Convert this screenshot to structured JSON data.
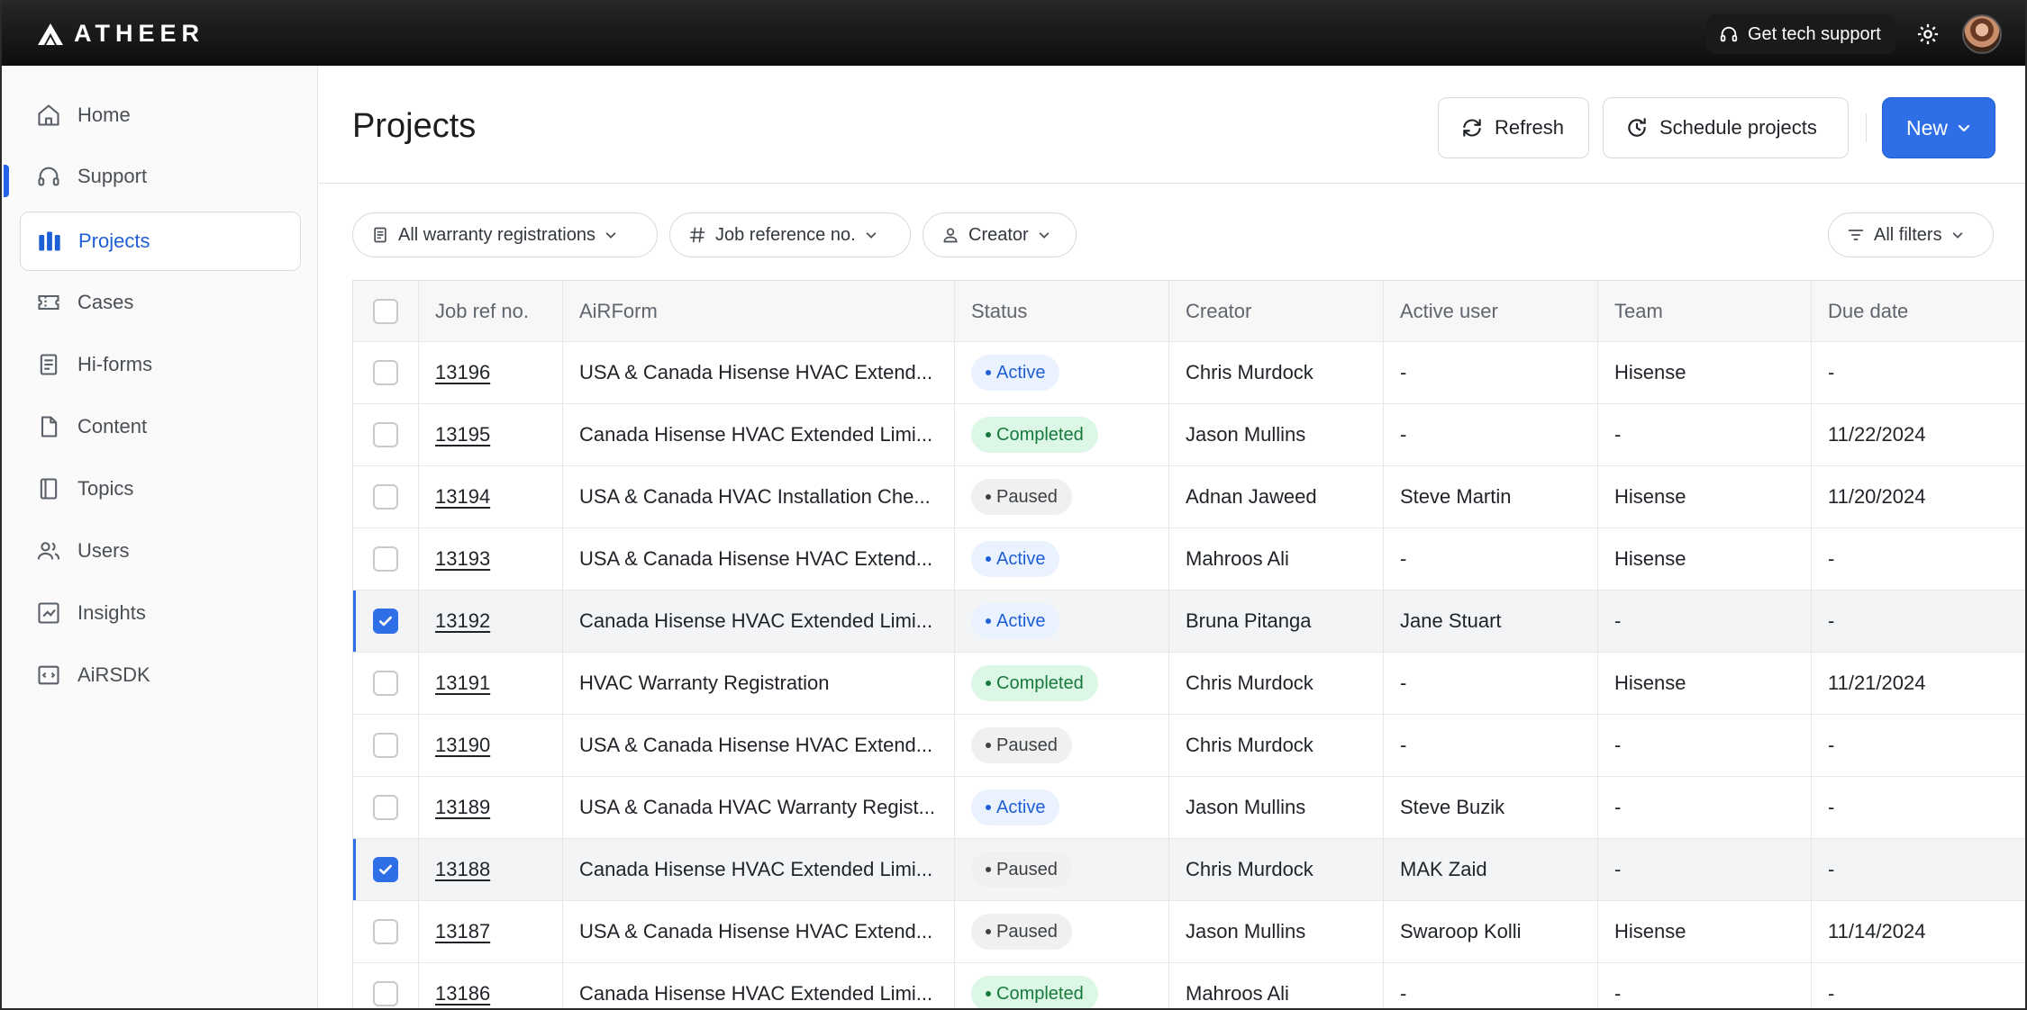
{
  "app": {
    "brand": "ATHEER",
    "support_label": "Get tech support"
  },
  "sidebar": {
    "items": [
      {
        "label": "Home",
        "icon": "home-icon"
      },
      {
        "label": "Support",
        "icon": "headset-icon"
      },
      {
        "label": "Projects",
        "icon": "projects-icon",
        "active": true
      },
      {
        "label": "Cases",
        "icon": "ticket-icon"
      },
      {
        "label": "Hi-forms",
        "icon": "form-icon"
      },
      {
        "label": "Content",
        "icon": "document-icon"
      },
      {
        "label": "Topics",
        "icon": "book-icon"
      },
      {
        "label": "Users",
        "icon": "users-icon"
      },
      {
        "label": "Insights",
        "icon": "chart-icon"
      },
      {
        "label": "AiRSDK",
        "icon": "code-icon"
      }
    ]
  },
  "header": {
    "title": "Projects",
    "refresh_label": "Refresh",
    "schedule_label": "Schedule projects",
    "new_label": "New"
  },
  "filters": {
    "warranty": "All warranty registrations",
    "jobref": "Job reference no.",
    "creator": "Creator",
    "all": "All filters"
  },
  "table": {
    "columns": [
      "Job ref no.",
      "AiRForm",
      "Status",
      "Creator",
      "Active user",
      "Team",
      "Due date"
    ],
    "rows": [
      {
        "checked": false,
        "job": "13196",
        "form": "USA & Canada Hisense HVAC Extend...",
        "status": "Active",
        "status_kind": "active",
        "creator": "Chris Murdock",
        "active_user": "-",
        "team": "Hisense",
        "due": "-"
      },
      {
        "checked": false,
        "job": "13195",
        "form": "Canada Hisense HVAC Extended Limi...",
        "status": "Completed",
        "status_kind": "completed",
        "creator": "Jason Mullins",
        "active_user": "-",
        "team": "-",
        "due": "11/22/2024"
      },
      {
        "checked": false,
        "job": "13194",
        "form": "USA & Canada HVAC Installation Che...",
        "status": "Paused",
        "status_kind": "paused",
        "creator": "Adnan Jaweed",
        "active_user": "Steve Martin",
        "team": "Hisense",
        "due": "11/20/2024"
      },
      {
        "checked": false,
        "job": "13193",
        "form": "USA & Canada Hisense HVAC Extend...",
        "status": "Active",
        "status_kind": "active",
        "creator": "Mahroos Ali",
        "active_user": "-",
        "team": "Hisense",
        "due": "-"
      },
      {
        "checked": true,
        "job": "13192",
        "form": "Canada Hisense HVAC Extended Limi...",
        "status": "Active",
        "status_kind": "active",
        "creator": "Bruna Pitanga",
        "active_user": "Jane Stuart",
        "team": "-",
        "due": "-"
      },
      {
        "checked": false,
        "job": "13191",
        "form": "HVAC Warranty Registration",
        "status": "Completed",
        "status_kind": "completed",
        "creator": "Chris Murdock",
        "active_user": "-",
        "team": "Hisense",
        "due": "11/21/2024"
      },
      {
        "checked": false,
        "job": "13190",
        "form": "USA & Canada Hisense HVAC Extend...",
        "status": "Paused",
        "status_kind": "paused",
        "creator": "Chris Murdock",
        "active_user": "-",
        "team": "-",
        "due": "-"
      },
      {
        "checked": false,
        "job": "13189",
        "form": "USA & Canada HVAC Warranty Regist...",
        "status": "Active",
        "status_kind": "active",
        "creator": "Jason Mullins",
        "active_user": "Steve Buzik",
        "team": "-",
        "due": "-"
      },
      {
        "checked": true,
        "job": "13188",
        "form": "Canada Hisense HVAC Extended Limi...",
        "status": "Paused",
        "status_kind": "paused",
        "creator": "Chris Murdock",
        "active_user": "MAK Zaid",
        "team": "-",
        "due": "-"
      },
      {
        "checked": false,
        "job": "13187",
        "form": "USA & Canada Hisense HVAC Extend...",
        "status": "Paused",
        "status_kind": "paused",
        "creator": "Jason Mullins",
        "active_user": "Swaroop Kolli",
        "team": "Hisense",
        "due": "11/14/2024"
      },
      {
        "checked": false,
        "job": "13186",
        "form": "Canada Hisense HVAC Extended Limi...",
        "status": "Completed",
        "status_kind": "completed",
        "creator": "Mahroos Ali",
        "active_user": "-",
        "team": "-",
        "due": "-"
      }
    ]
  }
}
